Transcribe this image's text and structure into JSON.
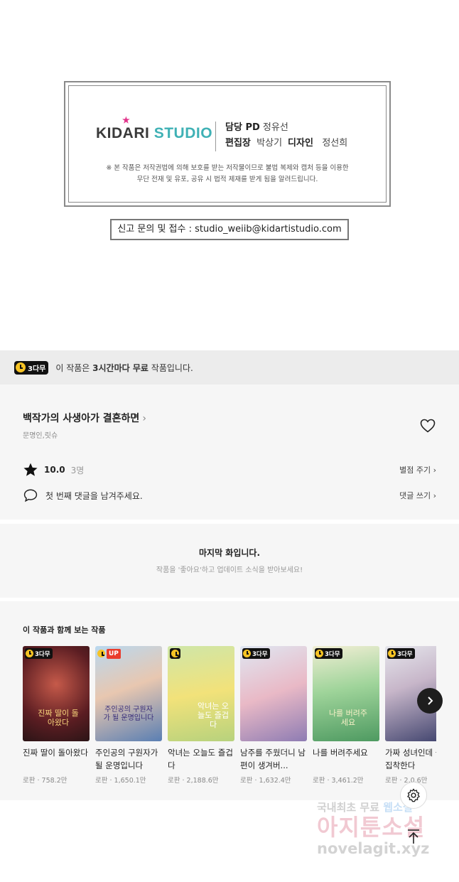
{
  "credit": {
    "logo_kid": "KID",
    "logo_a": "A",
    "logo_ri": "RI",
    "logo_studio": "STUDIO",
    "pd_label": "담당 PD",
    "pd_name": "정유선",
    "editor_label": "편집장",
    "editor_name": "박상기",
    "design_label": "디자인",
    "design_name": "정선희",
    "notice_line1": "※ 본 작품은 저작권법에 의해 보호를 받는 저작물이므로 불법 복제와 캡처 등을 이용한",
    "notice_line2": "무단 전재 및 유포, 공유 시 법적 제재를 받게 됨을 알려드립니다."
  },
  "report": {
    "text": "신고 문의 및 접수 : studio_weiib@kidartistudio.com"
  },
  "free_banner": {
    "badge": "3다무",
    "text_pre": "이 작품은 ",
    "text_bold": "3시간마다 무료",
    "text_post": " 작품입니다."
  },
  "work": {
    "title": "백작가의 사생아가 결혼하면",
    "authors": "문명인,릿슈",
    "score": "10.0",
    "rating_count": "3명",
    "rate_link": "별점 주기",
    "comment_prompt": "첫 번째 댓글을 남겨주세요.",
    "comment_link": "댓글 쓰기"
  },
  "last_episode": {
    "title": "마지막 화입니다.",
    "subtitle": "작품을 '좋아요'하고 업데이트 소식을 받아보세요!"
  },
  "recommend": {
    "heading": "이 작품과 함께 보는 작품",
    "items": [
      {
        "title": "진짜 딸이 돌아왔다",
        "meta": "로판 · 758.2만",
        "tag": "3다무",
        "cover_text": "진짜 딸이 돌아왔다"
      },
      {
        "title": "주인공의 구원자가 될 운명입니다",
        "meta": "로판 · 1,650.1만",
        "tag": "UP",
        "cover_text": "주인공의 구원자가 될 운명입니다"
      },
      {
        "title": "악녀는 오늘도 즐겁다",
        "meta": "로판 · 2,188.6만",
        "tag": "clock",
        "cover_text": "악녀는 오늘도 즐겁다"
      },
      {
        "title": "남주를 주웠더니 남편이 생겨버...",
        "meta": "로판 · 1,632.4만",
        "tag": "3다무",
        "cover_text": ""
      },
      {
        "title": "나를 버려주세요",
        "meta": "로판 · 3,461.2만",
        "tag": "3다무",
        "cover_text": "나를 버려주세요"
      },
      {
        "title": "가짜 성녀인데 들이 집착한다",
        "meta": "로판 · 2,0.6만",
        "tag": "3다무",
        "cover_text": ""
      }
    ]
  },
  "watermark": {
    "line1_a": "국내최초 무료 ",
    "line1_b": "웹소설",
    "line2": "아지툰소설",
    "line3": "novelagit.xyz"
  },
  "colors": {
    "studio_teal": "#3fb1b5",
    "star_pink": "#e2328a",
    "badge_yellow": "#f6c324",
    "up_red": "#ea3c2c"
  }
}
